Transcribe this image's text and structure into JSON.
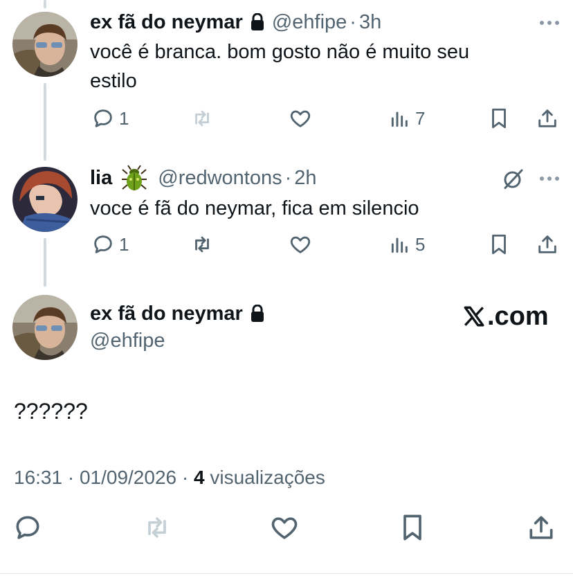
{
  "colors": {
    "text": "#0f1419",
    "secondary": "#536471",
    "line": "#cfd9de",
    "disabled": "#c4cfd6"
  },
  "reply1": {
    "name": "ex fã do neymar",
    "handle": "@ehfipe",
    "dot": "·",
    "time": "3h",
    "text_line1": "você é branca. bom gosto não é muito seu",
    "text_line2": "estilo",
    "replies": "1",
    "views": "7"
  },
  "reply2": {
    "name": "lia",
    "handle": "@redwontons",
    "dot": "·",
    "time": "2h",
    "text": "voce é fã do neymar, fica em silencio",
    "replies": "1",
    "views": "5"
  },
  "main": {
    "name": "ex fã do neymar",
    "handle": "@ehfipe",
    "watermark": ".com",
    "text": "??????",
    "timestamp": "16:31 · 01/09/2026 · ",
    "views_count": "4",
    "views_label": " visualizações"
  }
}
